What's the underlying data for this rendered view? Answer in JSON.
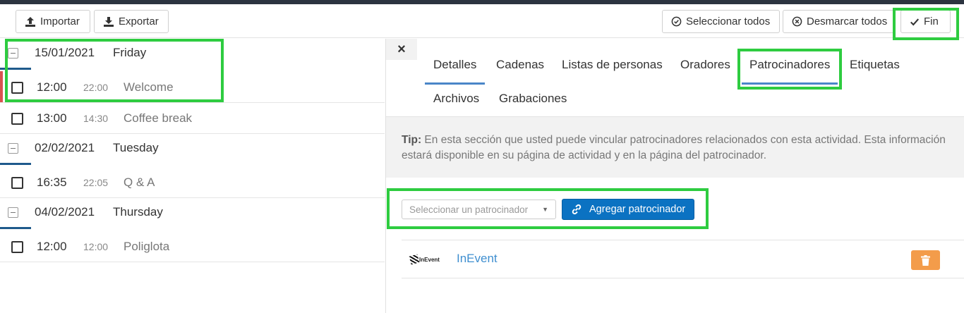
{
  "toolbar": {
    "import_label": "Importar",
    "export_label": "Exportar",
    "select_all_label": "Seleccionar todos",
    "deselect_all_label": "Desmarcar todos",
    "done_label": "Fin"
  },
  "schedule": {
    "days": [
      {
        "date": "15/01/2021",
        "weekday": "Friday",
        "activities": [
          {
            "start": "12:00",
            "end": "22:00",
            "name": "Welcome"
          },
          {
            "start": "13:00",
            "end": "14:30",
            "name": "Coffee break"
          }
        ]
      },
      {
        "date": "02/02/2021",
        "weekday": "Tuesday",
        "activities": [
          {
            "start": "16:35",
            "end": "22:05",
            "name": "Q & A"
          }
        ]
      },
      {
        "date": "04/02/2021",
        "weekday": "Thursday",
        "activities": [
          {
            "start": "12:00",
            "end": "12:00",
            "name": "Poliglota"
          }
        ]
      }
    ]
  },
  "panel": {
    "close_label": "×",
    "tabs": [
      {
        "label": "Detalles"
      },
      {
        "label": "Cadenas"
      },
      {
        "label": "Listas de personas"
      },
      {
        "label": "Oradores"
      },
      {
        "label": "Patrocinadores"
      },
      {
        "label": "Etiquetas"
      },
      {
        "label": "Archivos"
      },
      {
        "label": "Grabaciones"
      }
    ],
    "active_tab": "Patrocinadores",
    "tip_label": "Tip:",
    "tip_text": " En esta sección que usted puede vincular patrocinadores relacionados con esta actividad. Esta información estará disponible en su página de actividad y en la página del patrocinador.",
    "select_placeholder": "Seleccionar un patrocinador",
    "add_button_label": "Agregar patrocinador",
    "sponsors": [
      {
        "name": "InEvent",
        "logo_text": "InEvent"
      }
    ]
  },
  "colors": {
    "accent": "#0b72c2",
    "tab_underline": "#4a86c8",
    "highlight": "#2ecc40",
    "delete": "#f39c4a",
    "link": "#3f8fd0"
  },
  "icons": [
    "upload-icon",
    "download-icon",
    "check-circle-icon",
    "x-circle-icon",
    "check-icon",
    "close-icon",
    "link-icon",
    "trash-icon",
    "caret-down-icon"
  ]
}
